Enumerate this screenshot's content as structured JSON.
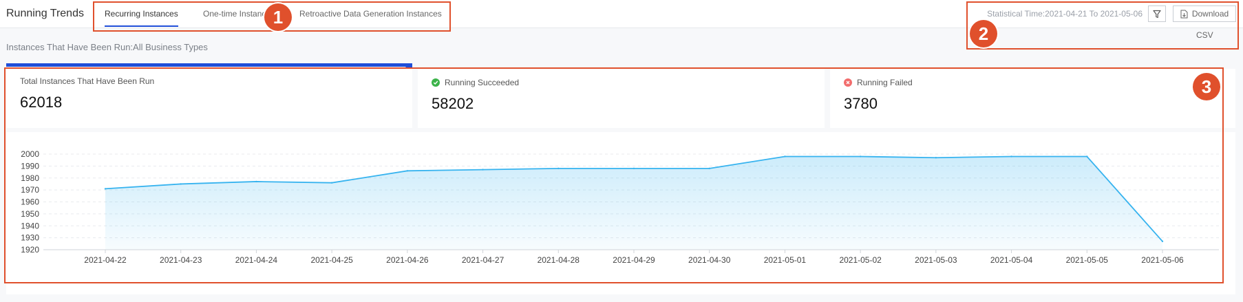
{
  "header": {
    "title": "Running Trends",
    "tabs": [
      {
        "label": "Recurring Instances",
        "active": true
      },
      {
        "label": "One-time Instances",
        "active": false
      },
      {
        "label": "Retroactive Data Generation Instances",
        "active": false
      }
    ],
    "statistical_time": "Statistical Time:2021-04-21 To 2021-05-06",
    "filter_icon": "filter-icon",
    "download_label": "Download",
    "download_sub": "CSV",
    "download_icon": "file-download-icon"
  },
  "scope": "Instances That Have Been Run:All Business Types",
  "cards": [
    {
      "label": "Total Instances That Have Been Run",
      "value": "62018"
    },
    {
      "label": "Running Succeeded",
      "value": "58202",
      "icon": "check-circle-icon",
      "color": "#3cb34a"
    },
    {
      "label": "Running Failed",
      "value": "3780",
      "icon": "error-circle-icon",
      "color": "#f26d6d"
    }
  ],
  "annotations": [
    "1",
    "2",
    "3"
  ],
  "colors": {
    "accent": "#1f4ed8",
    "line": "#36b3ef",
    "annotation": "#e0502c"
  },
  "chart_data": {
    "type": "area",
    "x": [
      "2021-04-22",
      "2021-04-23",
      "2021-04-24",
      "2021-04-25",
      "2021-04-26",
      "2021-04-27",
      "2021-04-28",
      "2021-04-29",
      "2021-04-30",
      "2021-05-01",
      "2021-05-02",
      "2021-05-03",
      "2021-05-04",
      "2021-05-05",
      "2021-05-06"
    ],
    "values": [
      1971,
      1975,
      1977,
      1976,
      1986,
      1987,
      1988,
      1988,
      1988,
      1998,
      1998,
      1997,
      1998,
      1998,
      1927
    ],
    "yticks": [
      1920,
      1930,
      1940,
      1950,
      1960,
      1970,
      1980,
      1990,
      2000
    ],
    "ylim": [
      1920,
      2000
    ],
    "grid": true
  }
}
